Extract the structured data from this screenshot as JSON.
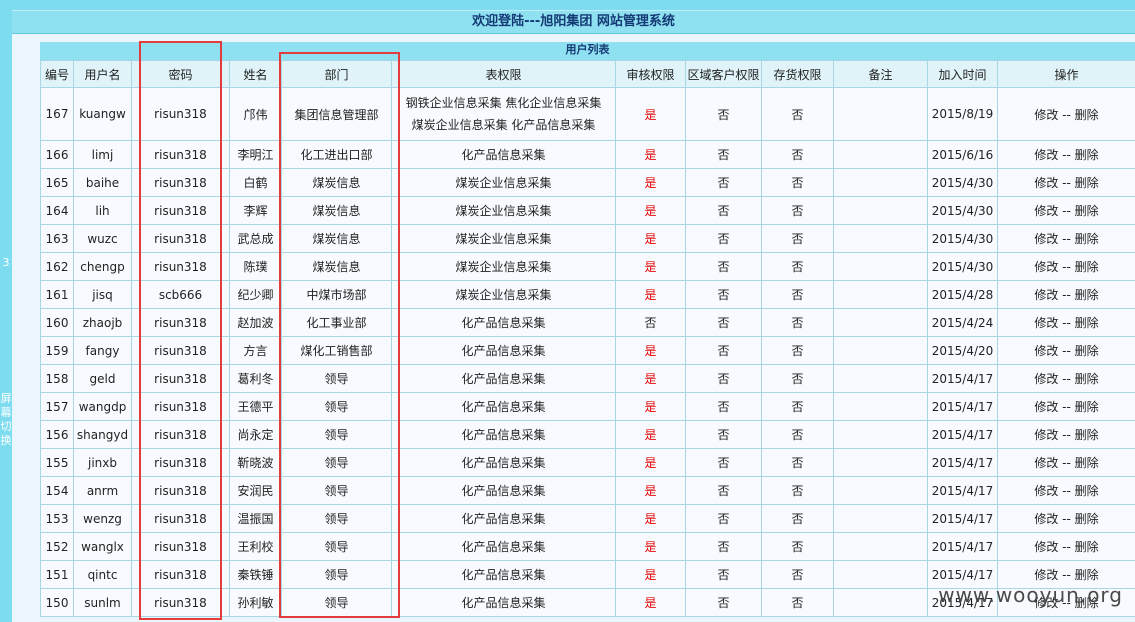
{
  "header": {
    "title": "欢迎登陆---旭阳集团 网站管理系统"
  },
  "sidebar": {
    "number": "3",
    "vertical_text": "屏幕切换"
  },
  "table": {
    "caption": "用户列表",
    "columns": [
      "编号",
      "用户名",
      "密码",
      "姓名",
      "部门",
      "表权限",
      "审核权限",
      "区域客户权限",
      "存货权限",
      "备注",
      "加入时间",
      "操作"
    ],
    "rows": [
      {
        "id": "167",
        "username": "kuangw",
        "password": "risun318",
        "name": "邝伟",
        "dept": "集团信息管理部",
        "perms": [
          "钢铁企业信息采集  焦化企业信息采集",
          "煤炭企业信息采集  化产品信息采集"
        ],
        "audit": "是",
        "region": "否",
        "stock": "否",
        "note": "",
        "date": "2015/8/19",
        "op_edit": "修改",
        "op_sep": " -- ",
        "op_delete": "删除"
      },
      {
        "id": "166",
        "username": "limj",
        "password": "risun318",
        "name": "李明江",
        "dept": "化工进出口部",
        "perms": [
          "化产品信息采集"
        ],
        "audit": "是",
        "region": "否",
        "stock": "否",
        "note": "",
        "date": "2015/6/16",
        "op_edit": "修改",
        "op_sep": " -- ",
        "op_delete": "删除"
      },
      {
        "id": "165",
        "username": "baihe",
        "password": "risun318",
        "name": "白鹤",
        "dept": "煤炭信息",
        "perms": [
          "煤炭企业信息采集"
        ],
        "audit": "是",
        "region": "否",
        "stock": "否",
        "note": "",
        "date": "2015/4/30",
        "op_edit": "修改",
        "op_sep": " -- ",
        "op_delete": "删除"
      },
      {
        "id": "164",
        "username": "lih",
        "password": "risun318",
        "name": "李辉",
        "dept": "煤炭信息",
        "perms": [
          "煤炭企业信息采集"
        ],
        "audit": "是",
        "region": "否",
        "stock": "否",
        "note": "",
        "date": "2015/4/30",
        "op_edit": "修改",
        "op_sep": " -- ",
        "op_delete": "删除"
      },
      {
        "id": "163",
        "username": "wuzc",
        "password": "risun318",
        "name": "武总成",
        "dept": "煤炭信息",
        "perms": [
          "煤炭企业信息采集"
        ],
        "audit": "是",
        "region": "否",
        "stock": "否",
        "note": "",
        "date": "2015/4/30",
        "op_edit": "修改",
        "op_sep": " -- ",
        "op_delete": "删除"
      },
      {
        "id": "162",
        "username": "chengp",
        "password": "risun318",
        "name": "陈璞",
        "dept": "煤炭信息",
        "perms": [
          "煤炭企业信息采集"
        ],
        "audit": "是",
        "region": "否",
        "stock": "否",
        "note": "",
        "date": "2015/4/30",
        "op_edit": "修改",
        "op_sep": " -- ",
        "op_delete": "删除"
      },
      {
        "id": "161",
        "username": "jisq",
        "password": "scb666",
        "name": "纪少卿",
        "dept": "中煤市场部",
        "perms": [
          "煤炭企业信息采集"
        ],
        "audit": "是",
        "region": "否",
        "stock": "否",
        "note": "",
        "date": "2015/4/28",
        "op_edit": "修改",
        "op_sep": " -- ",
        "op_delete": "删除"
      },
      {
        "id": "160",
        "username": "zhaojb",
        "password": "risun318",
        "name": "赵加波",
        "dept": "化工事业部",
        "perms": [
          "化产品信息采集"
        ],
        "audit": "否",
        "region": "否",
        "stock": "否",
        "note": "",
        "date": "2015/4/24",
        "op_edit": "修改",
        "op_sep": " -- ",
        "op_delete": "删除"
      },
      {
        "id": "159",
        "username": "fangy",
        "password": "risun318",
        "name": "方言",
        "dept": "煤化工销售部",
        "perms": [
          "化产品信息采集"
        ],
        "audit": "是",
        "region": "否",
        "stock": "否",
        "note": "",
        "date": "2015/4/20",
        "op_edit": "修改",
        "op_sep": " -- ",
        "op_delete": "删除"
      },
      {
        "id": "158",
        "username": "geld",
        "password": "risun318",
        "name": "葛利冬",
        "dept": "领导",
        "perms": [
          "化产品信息采集"
        ],
        "audit": "是",
        "region": "否",
        "stock": "否",
        "note": "",
        "date": "2015/4/17",
        "op_edit": "修改",
        "op_sep": " -- ",
        "op_delete": "删除"
      },
      {
        "id": "157",
        "username": "wangdp",
        "password": "risun318",
        "name": "王德平",
        "dept": "领导",
        "perms": [
          "化产品信息采集"
        ],
        "audit": "是",
        "region": "否",
        "stock": "否",
        "note": "",
        "date": "2015/4/17",
        "op_edit": "修改",
        "op_sep": " -- ",
        "op_delete": "删除"
      },
      {
        "id": "156",
        "username": "shangyd",
        "password": "risun318",
        "name": "尚永定",
        "dept": "领导",
        "perms": [
          "化产品信息采集"
        ],
        "audit": "是",
        "region": "否",
        "stock": "否",
        "note": "",
        "date": "2015/4/17",
        "op_edit": "修改",
        "op_sep": " -- ",
        "op_delete": "删除"
      },
      {
        "id": "155",
        "username": "jinxb",
        "password": "risun318",
        "name": "靳晓波",
        "dept": "领导",
        "perms": [
          "化产品信息采集"
        ],
        "audit": "是",
        "region": "否",
        "stock": "否",
        "note": "",
        "date": "2015/4/17",
        "op_edit": "修改",
        "op_sep": " -- ",
        "op_delete": "删除"
      },
      {
        "id": "154",
        "username": "anrm",
        "password": "risun318",
        "name": "安润民",
        "dept": "领导",
        "perms": [
          "化产品信息采集"
        ],
        "audit": "是",
        "region": "否",
        "stock": "否",
        "note": "",
        "date": "2015/4/17",
        "op_edit": "修改",
        "op_sep": " -- ",
        "op_delete": "删除"
      },
      {
        "id": "153",
        "username": "wenzg",
        "password": "risun318",
        "name": "温振国",
        "dept": "领导",
        "perms": [
          "化产品信息采集"
        ],
        "audit": "是",
        "region": "否",
        "stock": "否",
        "note": "",
        "date": "2015/4/17",
        "op_edit": "修改",
        "op_sep": " -- ",
        "op_delete": "删除"
      },
      {
        "id": "152",
        "username": "wanglx",
        "password": "risun318",
        "name": "王利校",
        "dept": "领导",
        "perms": [
          "化产品信息采集"
        ],
        "audit": "是",
        "region": "否",
        "stock": "否",
        "note": "",
        "date": "2015/4/17",
        "op_edit": "修改",
        "op_sep": " -- ",
        "op_delete": "删除"
      },
      {
        "id": "151",
        "username": "qintc",
        "password": "risun318",
        "name": "秦铁锤",
        "dept": "领导",
        "perms": [
          "化产品信息采集"
        ],
        "audit": "是",
        "region": "否",
        "stock": "否",
        "note": "",
        "date": "2015/4/17",
        "op_edit": "修改",
        "op_sep": " -- ",
        "op_delete": "删除"
      },
      {
        "id": "150",
        "username": "sunlm",
        "password": "risun318",
        "name": "孙利敏",
        "dept": "领导",
        "perms": [
          "化产品信息采集"
        ],
        "audit": "是",
        "region": "否",
        "stock": "否",
        "note": "",
        "date": "2015/4/17",
        "op_edit": "修改",
        "op_sep": " -- ",
        "op_delete": "删除"
      }
    ]
  },
  "watermark": "www.wooyun.org",
  "colors": {
    "header_bg": "#7ddcef",
    "accent_red": "#e33c3c",
    "yes_red": "#e60000"
  }
}
